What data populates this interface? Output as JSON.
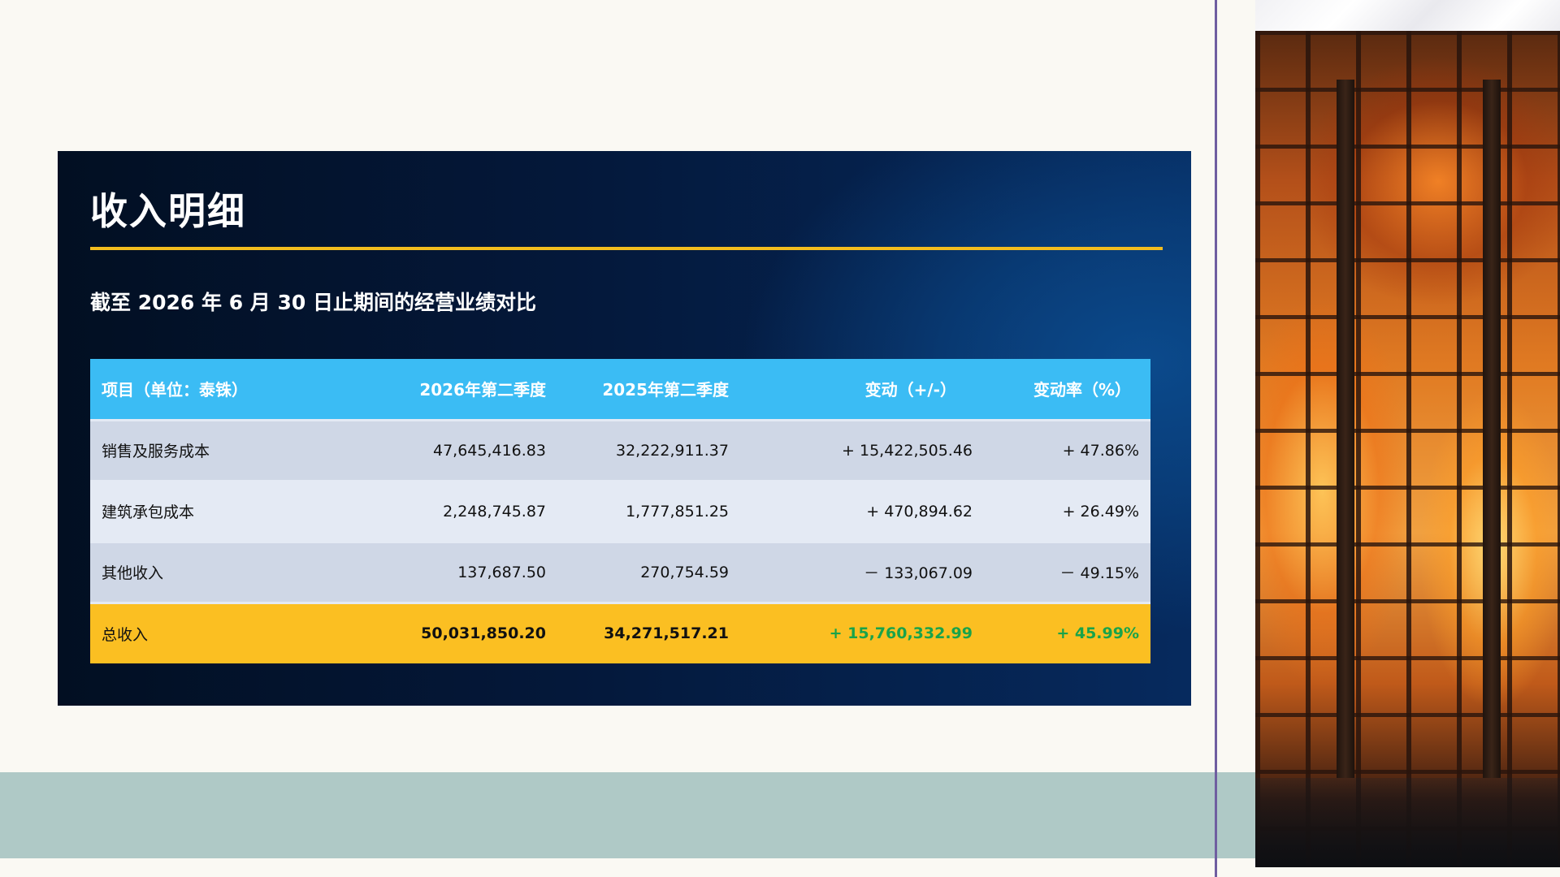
{
  "slide": {
    "title": "收入明细",
    "subtitle": "截至 2026 年 6 月 30 日止期间的经营业绩对比"
  },
  "table": {
    "headers": {
      "item": "项目（单位：泰铢）",
      "q2_2026": "2026年第二季度",
      "q2_2025": "2025年第二季度",
      "change": "变动（+/-）",
      "change_rate": "变动率（%）"
    },
    "rows": [
      {
        "item": "销售及服务成本",
        "q2_2026": "47,645,416.83",
        "q2_2025": "32,222,911.37",
        "change": "+ 15,422,505.46",
        "change_rate": "+ 47.86%"
      },
      {
        "item": "建筑承包成本",
        "q2_2026": "2,248,745.87",
        "q2_2025": "1,777,851.25",
        "change": "+ 470,894.62",
        "change_rate": "+ 26.49%"
      },
      {
        "item": "其他收入",
        "q2_2026": "137,687.50",
        "q2_2025": "270,754.59",
        "change": "－ 133,067.09",
        "change_rate": "－ 49.15%"
      }
    ],
    "total": {
      "item": "总收入",
      "q2_2026": "50,031,850.20",
      "q2_2025": "34,271,517.21",
      "change": "+ 15,760,332.99",
      "change_rate": "+ 45.99%"
    }
  },
  "colors": {
    "accent_gold": "#f3bd1e",
    "header_blue": "#3bbcf4",
    "total_row": "#fbbf22",
    "positive": "#1e9e4a",
    "negative": "#ec7a72",
    "band_teal": "#afc9c6",
    "divider_purple": "#6f5ea0"
  },
  "image": {
    "subject": "burning-building-photo"
  }
}
